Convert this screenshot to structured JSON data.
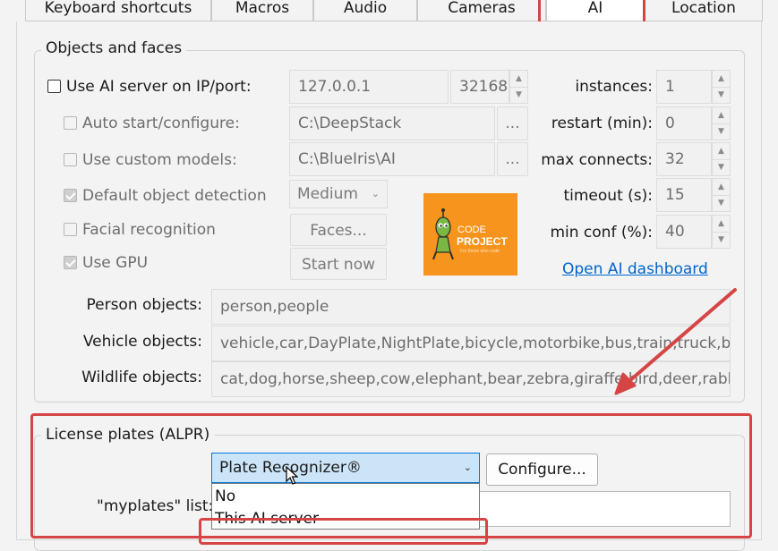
{
  "tabs": [
    {
      "label": "Keyboard shortcuts",
      "active": false
    },
    {
      "label": "Macros",
      "active": false
    },
    {
      "label": "Audio",
      "active": false
    },
    {
      "label": "Cameras",
      "active": false
    },
    {
      "label": "AI",
      "active": true
    },
    {
      "label": "Location",
      "active": false
    }
  ],
  "objects_group": {
    "title": "Objects and faces",
    "use_ai_server": {
      "label": "Use AI server on IP/port:",
      "checked": false
    },
    "ip": "127.0.0.1",
    "port": "32168",
    "auto_start": {
      "label": "Auto start/configure:",
      "checked": false,
      "path": "C:\\DeepStack",
      "browse": "..."
    },
    "custom_models": {
      "label": "Use custom models:",
      "checked": false,
      "path": "C:\\BlueIris\\AI",
      "browse": "..."
    },
    "default_detection": {
      "label": "Default object detection",
      "checked": true,
      "mode": "Medium"
    },
    "facial_recognition": {
      "label": "Facial recognition",
      "checked": false,
      "button": "Faces..."
    },
    "use_gpu": {
      "label": "Use GPU",
      "checked": true,
      "button": "Start now"
    },
    "logo": {
      "line1": "CODE",
      "line2": "PROJECT",
      "tagline": "For those who code"
    },
    "settings": [
      {
        "label": "instances:",
        "value": "1"
      },
      {
        "label": "restart (min):",
        "value": "0"
      },
      {
        "label": "max connects:",
        "value": "32"
      },
      {
        "label": "timeout (s):",
        "value": "15"
      },
      {
        "label": "min conf (%):",
        "value": "40"
      }
    ],
    "dashboard_link": "Open AI dashboard",
    "person": {
      "label": "Person objects:",
      "value": "person,people"
    },
    "vehicle": {
      "label": "Vehicle objects:",
      "value": "vehicle,car,DayPlate,NightPlate,bicycle,motorbike,bus,train,truck,boat"
    },
    "wildlife": {
      "label": "Wildlife objects:",
      "value": "cat,dog,horse,sheep,cow,elephant,bear,zebra,giraffe,bird,deer,rabbit,racc"
    }
  },
  "alpr_group": {
    "title": "License plates (ALPR)",
    "selected": "Plate Recognizer®",
    "configure": "Configure...",
    "myplates_label": "\"myplates\" list:",
    "options": [
      "No",
      "This AI server"
    ]
  },
  "colors": {
    "annotation": "#d64545",
    "link": "#0066cc",
    "logo_bg": "#f7941d",
    "selection": "#cce4f7"
  }
}
